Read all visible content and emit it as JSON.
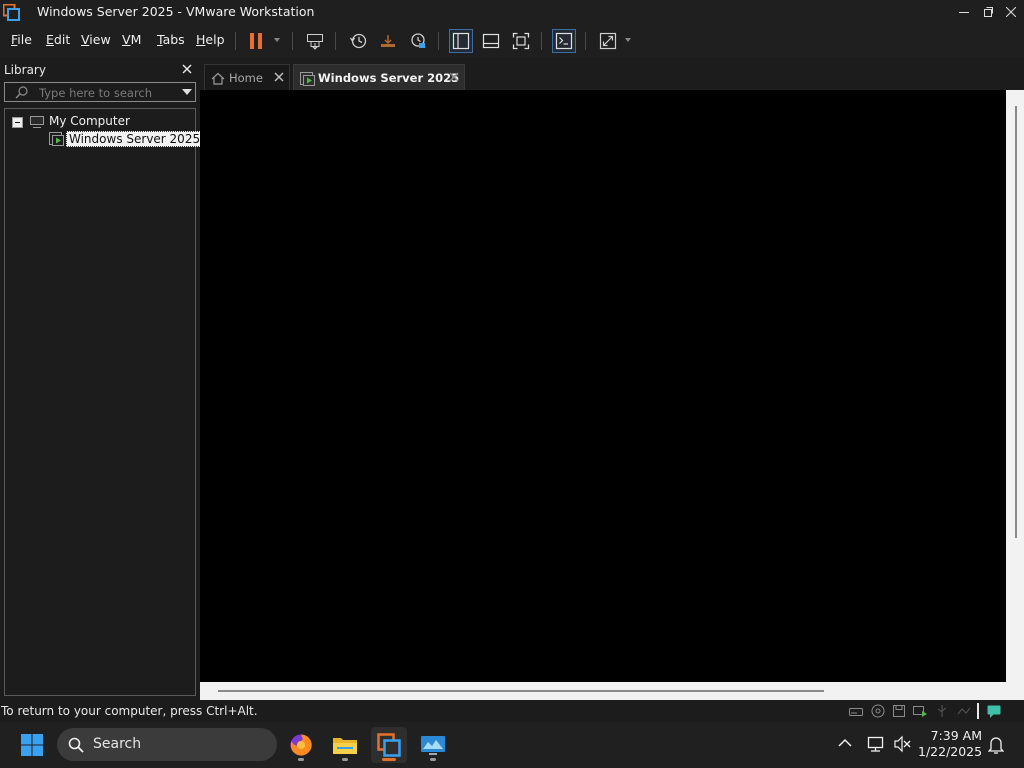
{
  "window": {
    "title": "Windows Server 2025 - VMware Workstation"
  },
  "menu": {
    "file": "File",
    "edit": "Edit",
    "view": "View",
    "vm": "VM",
    "tabs": "Tabs",
    "help": "Help"
  },
  "toolbar": {
    "icons": [
      "pause-icon",
      "send-ctrl-alt-del-icon",
      "snapshot-icon",
      "revert-snapshot-icon",
      "snapshot-manager-icon",
      "show-library-icon",
      "thumbnail-bar-icon",
      "full-screen-icon",
      "console-view-icon",
      "stretch-guest-icon"
    ]
  },
  "library": {
    "title": "Library",
    "search_placeholder": "Type here to search",
    "tree": {
      "root_label": "My Computer",
      "vm_label": "Windows Server 2025"
    }
  },
  "tabs": {
    "home": "Home",
    "vm": "Windows Server 2025"
  },
  "statusbar": {
    "message": "To return to your computer, press Ctrl+Alt."
  },
  "taskbar": {
    "search_label": "Search",
    "time": "7:39 AM",
    "date": "1/22/2025"
  },
  "colors": {
    "accent_orange": "#e8702a",
    "vm_green": "#4fb848",
    "windows_blue": "#3aa0f0"
  }
}
